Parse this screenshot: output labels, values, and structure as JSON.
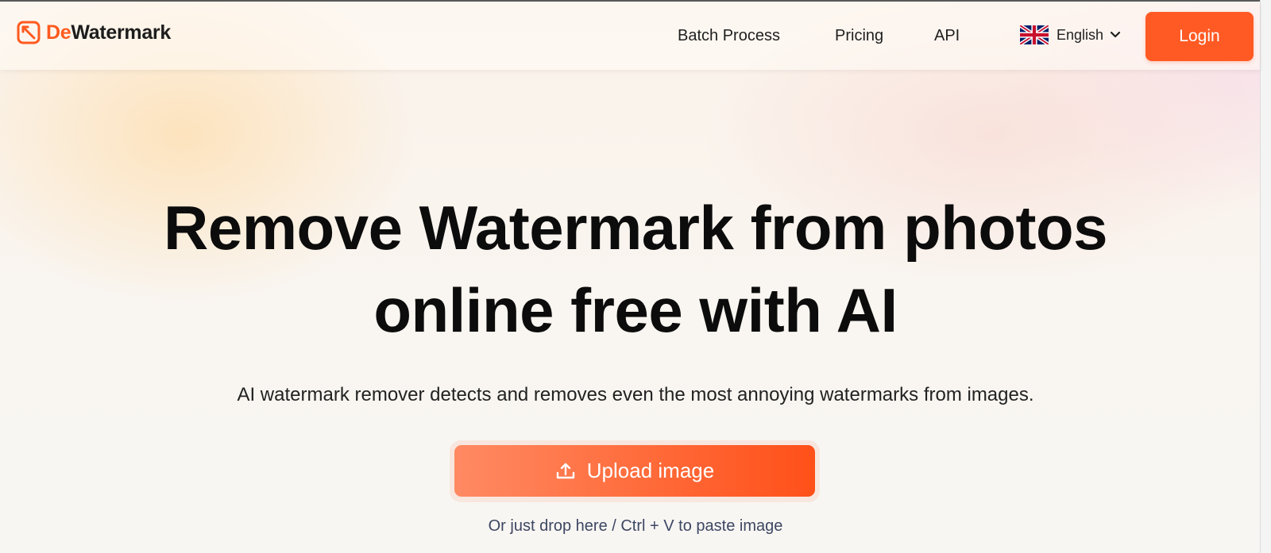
{
  "brand": {
    "prefix": "De",
    "suffix": "Watermark",
    "accent": "#ff5a1f"
  },
  "nav": {
    "batch_process": "Batch Process",
    "pricing": "Pricing",
    "api": "API"
  },
  "language": {
    "label": "English",
    "flag": "uk-flag-icon"
  },
  "login_label": "Login",
  "hero": {
    "title": "Remove Watermark from photos online free with AI",
    "subtitle": "AI watermark remover detects and removes even the most annoying watermarks from images.",
    "upload_label": "Upload image",
    "hint": "Or just drop here / Ctrl + V to paste image"
  },
  "colors": {
    "primary_button": "#ff5a24",
    "text": "#0c0c0c",
    "hint": "#3d4763"
  }
}
